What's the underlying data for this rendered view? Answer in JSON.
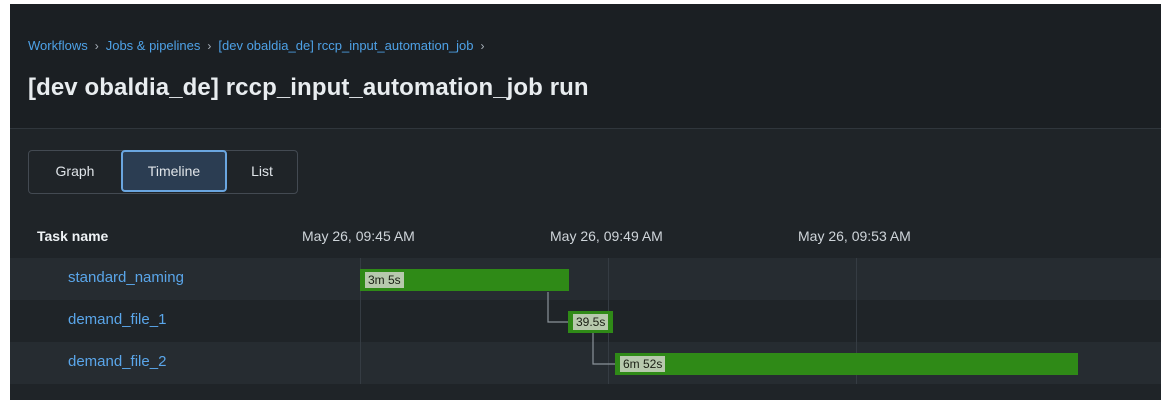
{
  "breadcrumb": {
    "items": [
      "Workflows",
      "Jobs & pipelines",
      "[dev obaldia_de] rccp_input_automation_job"
    ],
    "separator": "›"
  },
  "page_title": "[dev obaldia_de] rccp_input_automation_job run",
  "tabs": [
    {
      "label": "Graph",
      "selected": false
    },
    {
      "label": "Timeline",
      "selected": true
    },
    {
      "label": "List",
      "selected": false
    }
  ],
  "timeline": {
    "column_header": "Task name",
    "time_labels": [
      "May 26, 09:45 AM",
      "May 26, 09:49 AM",
      "May 26, 09:53 AM"
    ],
    "tasks": [
      {
        "name": "standard_naming",
        "duration": "3m 5s"
      },
      {
        "name": "demand_file_1",
        "duration": "39.5s"
      },
      {
        "name": "demand_file_2",
        "duration": "6m 52s"
      }
    ],
    "bar_color": "#2f8a17"
  }
}
